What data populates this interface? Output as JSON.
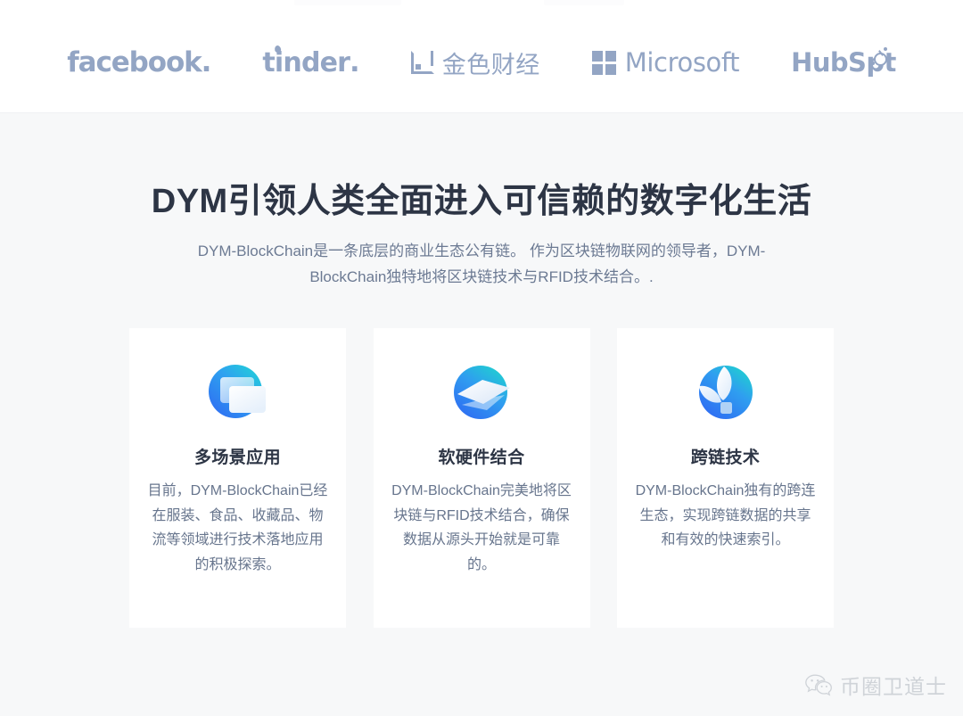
{
  "page": {
    "background": "#f7f8f9",
    "band_background": "#ffffff",
    "logo_color": "#93a5c4",
    "heading_color": "#2d3545",
    "body_color": "#67758d"
  },
  "logo_band": {
    "logos": [
      {
        "name": "facebook",
        "text": "facebook",
        "suffix": "."
      },
      {
        "name": "tinder",
        "text": "tinder",
        "suffix": "."
      },
      {
        "name": "jinse-caijing",
        "text": "金色财经"
      },
      {
        "name": "microsoft",
        "text": "Microsoft"
      },
      {
        "name": "hubspot",
        "text_a": "HubSp",
        "text_b": "t"
      }
    ]
  },
  "hero": {
    "title": "DYM引领人类全面进入可信赖的数字化生活",
    "subtitle": "DYM-BlockChain是一条底层的商业生态公有链。 作为区块链物联网的领导者，DYM-BlockChain独特地将区块链技术与RFID技术结合。."
  },
  "cards": [
    {
      "icon": "window-stack-icon",
      "title": "多场景应用",
      "body": "目前，DYM-BlockChain已经在服装、食品、收藏品、物流等领域进行技术落地应用的积极探索。"
    },
    {
      "icon": "stacked-diamonds-icon",
      "title": "软硬件结合",
      "body": "DYM-BlockChain完美地将区块链与RFID技术结合，确保数据从源头开始就是可靠的。"
    },
    {
      "icon": "leaf-sphere-icon",
      "title": "跨链技术",
      "body": "DYM-BlockChain独有的跨连生态，实现跨链数据的共享和有效的快速索引。"
    }
  ],
  "watermark": {
    "icon": "wechat-icon",
    "text": "币圈卫道士"
  }
}
